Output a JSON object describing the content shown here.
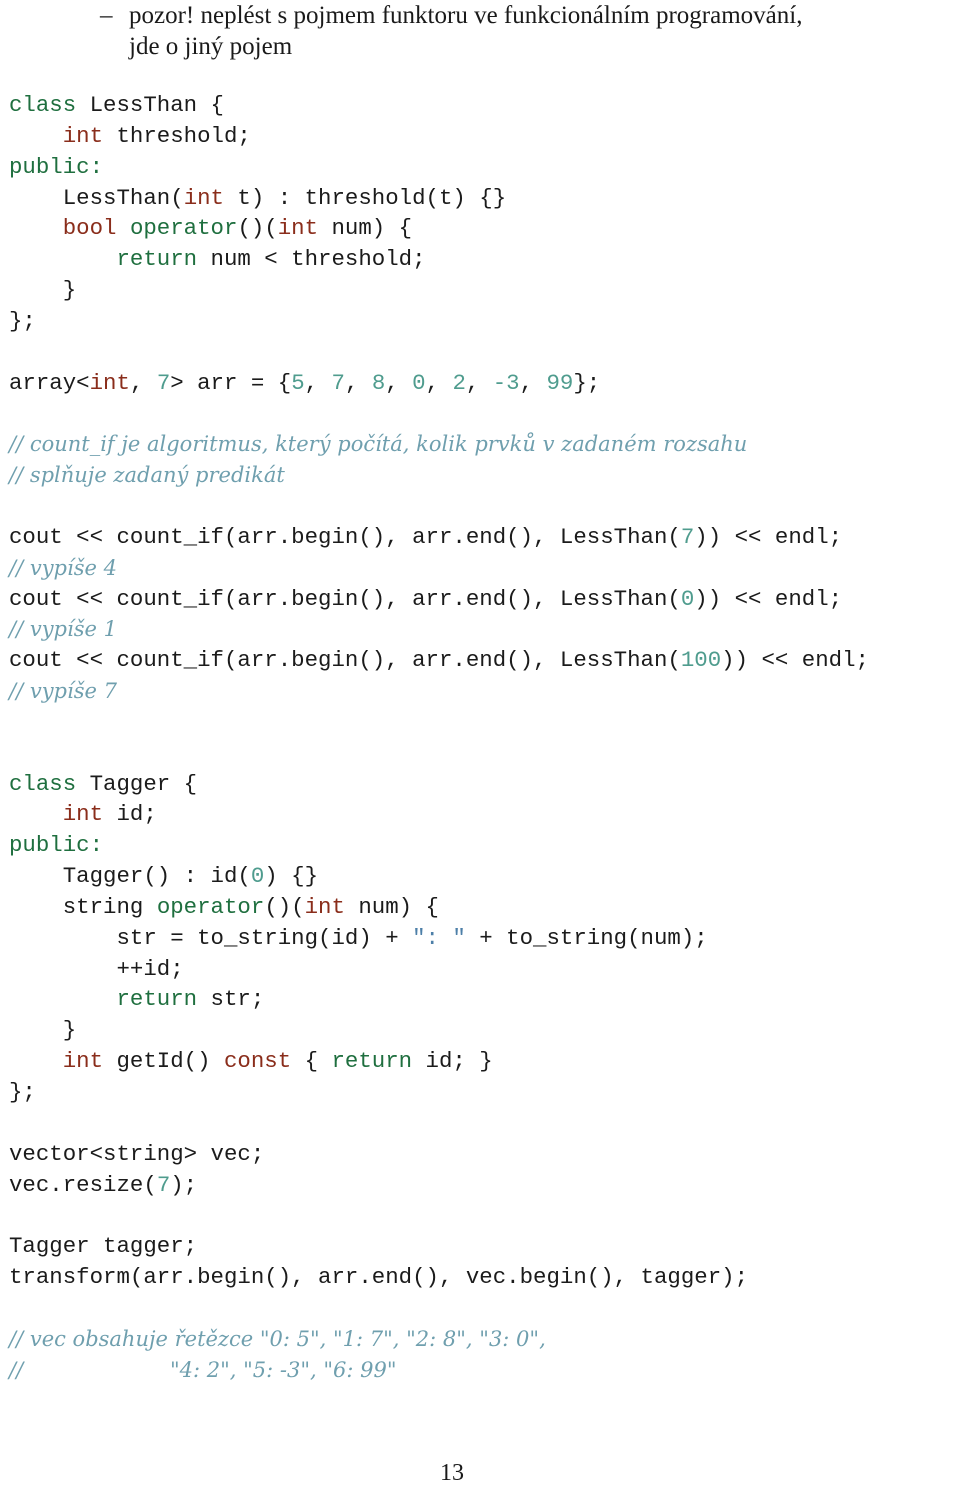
{
  "bullet": {
    "marker": "–",
    "lines": [
      "pozor! neplést s pojmem funktoru ve funkcionálním programování,",
      "jde o jiný pojem"
    ]
  },
  "code_lines": [
    [
      {
        "t": "class",
        "c": "kw"
      },
      {
        "t": " LessThan {"
      }
    ],
    [
      {
        "t": "    "
      },
      {
        "t": "int",
        "c": "ty"
      },
      {
        "t": " threshold;"
      }
    ],
    [
      {
        "t": "public:",
        "c": "kw"
      }
    ],
    [
      {
        "t": "    LessThan("
      },
      {
        "t": "int",
        "c": "ty"
      },
      {
        "t": " t) : threshold(t) {}"
      }
    ],
    [
      {
        "t": "    "
      },
      {
        "t": "bool",
        "c": "ty"
      },
      {
        "t": " "
      },
      {
        "t": "operator",
        "c": "kw"
      },
      {
        "t": "()("
      },
      {
        "t": "int",
        "c": "ty"
      },
      {
        "t": " num) {"
      }
    ],
    [
      {
        "t": "        "
      },
      {
        "t": "return",
        "c": "kw"
      },
      {
        "t": " num < threshold;"
      }
    ],
    [
      {
        "t": "    }"
      }
    ],
    [
      {
        "t": "};"
      }
    ],
    [],
    [
      {
        "t": "array<"
      },
      {
        "t": "int",
        "c": "ty"
      },
      {
        "t": ", "
      },
      {
        "t": "7",
        "c": "nu"
      },
      {
        "t": "> arr = {"
      },
      {
        "t": "5",
        "c": "nu"
      },
      {
        "t": ", "
      },
      {
        "t": "7",
        "c": "nu"
      },
      {
        "t": ", "
      },
      {
        "t": "8",
        "c": "nu"
      },
      {
        "t": ", "
      },
      {
        "t": "0",
        "c": "nu"
      },
      {
        "t": ", "
      },
      {
        "t": "2",
        "c": "nu"
      },
      {
        "t": ", "
      },
      {
        "t": "-3",
        "c": "nu"
      },
      {
        "t": ", "
      },
      {
        "t": "99",
        "c": "nu"
      },
      {
        "t": "};"
      }
    ],
    [],
    [
      {
        "t": "// count_if je algoritmus, který počítá, kolik prvků v zadaném rozsahu",
        "c": "cm"
      }
    ],
    [
      {
        "t": "// splňuje zadaný predikát",
        "c": "cm"
      }
    ],
    [],
    [
      {
        "t": "cout << count_if(arr.begin(), arr.end(), LessThan("
      },
      {
        "t": "7",
        "c": "nu"
      },
      {
        "t": ")) << endl;"
      }
    ],
    [
      {
        "t": "// vypíše 4",
        "c": "cm"
      }
    ],
    [
      {
        "t": "cout << count_if(arr.begin(), arr.end(), LessThan("
      },
      {
        "t": "0",
        "c": "nu"
      },
      {
        "t": ")) << endl;"
      }
    ],
    [
      {
        "t": "// vypíše 1",
        "c": "cm"
      }
    ],
    [
      {
        "t": "cout << count_if(arr.begin(), arr.end(), LessThan("
      },
      {
        "t": "100",
        "c": "nu"
      },
      {
        "t": ")) << endl;"
      }
    ],
    [
      {
        "t": "// vypíše 7",
        "c": "cm"
      }
    ],
    [],
    [],
    [
      {
        "t": "class",
        "c": "kw"
      },
      {
        "t": " Tagger {"
      }
    ],
    [
      {
        "t": "    "
      },
      {
        "t": "int",
        "c": "ty"
      },
      {
        "t": " id;"
      }
    ],
    [
      {
        "t": "public:",
        "c": "kw"
      }
    ],
    [
      {
        "t": "    Tagger() : id("
      },
      {
        "t": "0",
        "c": "nu"
      },
      {
        "t": ") {}"
      }
    ],
    [
      {
        "t": "    string "
      },
      {
        "t": "operator",
        "c": "kw"
      },
      {
        "t": "()("
      },
      {
        "t": "int",
        "c": "ty"
      },
      {
        "t": " num) {"
      }
    ],
    [
      {
        "t": "        str = to_string(id) + "
      },
      {
        "t": "\": \"",
        "c": "st"
      },
      {
        "t": " + to_string(num);"
      }
    ],
    [
      {
        "t": "        ++id;"
      }
    ],
    [
      {
        "t": "        "
      },
      {
        "t": "return",
        "c": "kw"
      },
      {
        "t": " str;"
      }
    ],
    [
      {
        "t": "    }"
      }
    ],
    [
      {
        "t": "    "
      },
      {
        "t": "int",
        "c": "ty"
      },
      {
        "t": " getId() "
      },
      {
        "t": "const",
        "c": "ty"
      },
      {
        "t": " { "
      },
      {
        "t": "return",
        "c": "kw"
      },
      {
        "t": " id; }"
      }
    ],
    [
      {
        "t": "};"
      }
    ],
    [],
    [
      {
        "t": "vector<string> vec;"
      }
    ],
    [
      {
        "t": "vec.resize("
      },
      {
        "t": "7",
        "c": "nu"
      },
      {
        "t": ");"
      }
    ],
    [],
    [
      {
        "t": "Tagger tagger;"
      }
    ],
    [
      {
        "t": "transform(arr.begin(), arr.end(), vec.begin(), tagger);"
      }
    ],
    [],
    [
      {
        "t": "// vec obsahuje řetězce \"0: 5\", \"1: 7\", \"2: 8\", \"3: 0\",",
        "c": "cm"
      }
    ],
    [
      {
        "t": "//                      \"4: 2\", \"5: -3\", \"6: 99\"",
        "c": "cm"
      }
    ]
  ],
  "page_number": "13"
}
